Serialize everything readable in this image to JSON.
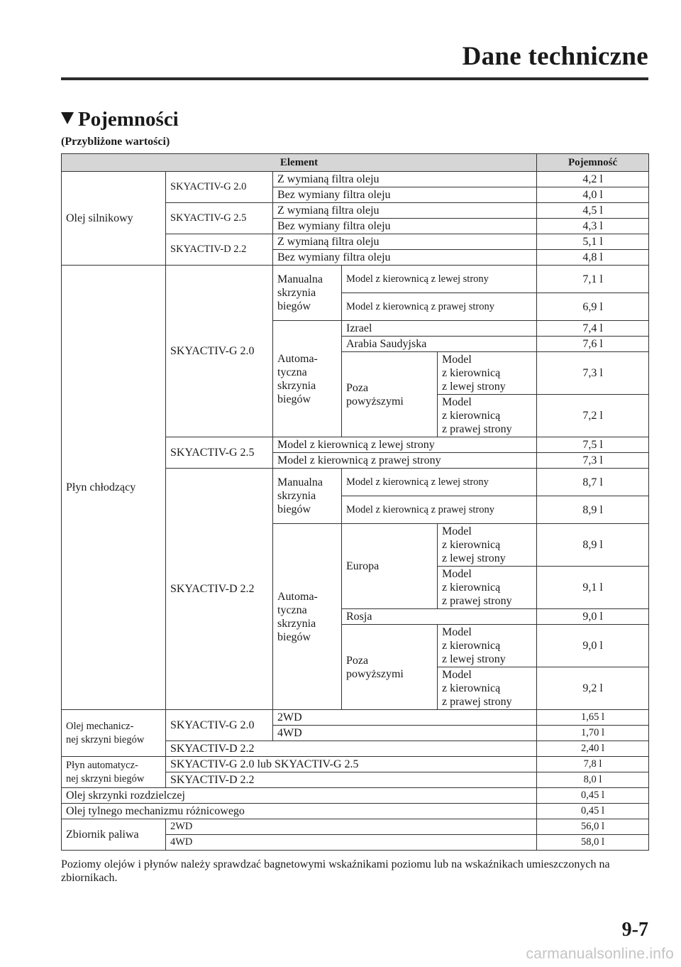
{
  "header": {
    "title": "Dane techniczne"
  },
  "section": {
    "title": "Pojemności",
    "subtitle": "(Przybliżone wartości)"
  },
  "table": {
    "headers": {
      "element": "Element",
      "capacity": "Pojemność"
    },
    "oil": {
      "label": "Olej silnikowy",
      "g20": "SKYACTIV-G 2.0",
      "g25": "SKYACTIV-G 2.5",
      "d22": "SKYACTIV-D 2.2",
      "with_filter": "Z wymianą filtra oleju",
      "without_filter": "Bez wymiany filtra oleju",
      "values": [
        "4,2 l",
        "4,0 l",
        "4,5 l",
        "4,3 l",
        "5,1 l",
        "4,8 l"
      ]
    },
    "coolant": {
      "label": "Płyn chłodzący",
      "g20": "SKYACTIV-G 2.0",
      "g25": "SKYACTIV-G 2.5",
      "d22": "SKYACTIV-D 2.2",
      "manual": "Manualna skrzynia biegów",
      "auto": "Automa-\ntyczna\nskrzynia\nbiegów",
      "lhd": "Model z kierownicą z lewej strony",
      "rhd": "Model z kierownicą z prawej strony",
      "model_lhd": "Model\nz kierownicą\nz lewej strony",
      "model_rhd": "Model\nz kierownicą\nz prawej strony",
      "israel": "Izrael",
      "saudi": "Arabia Saudyjska",
      "other": "Poza\npowyższymi",
      "europe": "Europa",
      "russia": "Rosja",
      "values": {
        "g20_man_lhd": "7,1 l",
        "g20_man_rhd": "6,9 l",
        "g20_israel": "7,4 l",
        "g20_saudi": "7,6 l",
        "g20_other_lhd": "7,3 l",
        "g20_other_rhd": "7,2 l",
        "g25_lhd": "7,5 l",
        "g25_rhd": "7,3 l",
        "d22_man_lhd": "8,7 l",
        "d22_man_rhd": "8,9 l",
        "d22_eu_lhd": "8,9 l",
        "d22_eu_rhd": "9,1 l",
        "d22_russia": "9,0 l",
        "d22_other_lhd": "9,0 l",
        "d22_other_rhd": "9,2 l"
      }
    },
    "manual_gear_oil": {
      "label": "Olej mechanicz-\nnej skrzyni biegów",
      "g20": "SKYACTIV-G 2.0",
      "d22": "SKYACTIV-D 2.2",
      "wd2": "2WD",
      "wd4": "4WD",
      "values": [
        "1,65 l",
        "1,70 l",
        "2,40 l"
      ]
    },
    "atf": {
      "label": "Płyn automatycz-\nnej skrzyni biegów",
      "g": "SKYACTIV-G 2.0 lub SKYACTIV-G 2.5",
      "d22": "SKYACTIV-D 2.2",
      "values": [
        "7,8 l",
        "8,0 l"
      ]
    },
    "transfer": {
      "label": "Olej skrzynki rozdzielczej",
      "value": "0,45 l"
    },
    "rear_diff": {
      "label": "Olej tylnego mechanizmu różnicowego",
      "value": "0,45 l"
    },
    "fuel": {
      "label": "Zbiornik paliwa",
      "wd2": "2WD",
      "wd4": "4WD",
      "values": [
        "56,0 l",
        "58,0 l"
      ]
    }
  },
  "note": "Poziomy olejów i płynów należy sprawdzać bagnetowymi wskaźnikami poziomu lub na wskaźnikach umieszczonych na zbiornikach.",
  "page_number": "9-7",
  "watermark": "carmanualsonline.info"
}
